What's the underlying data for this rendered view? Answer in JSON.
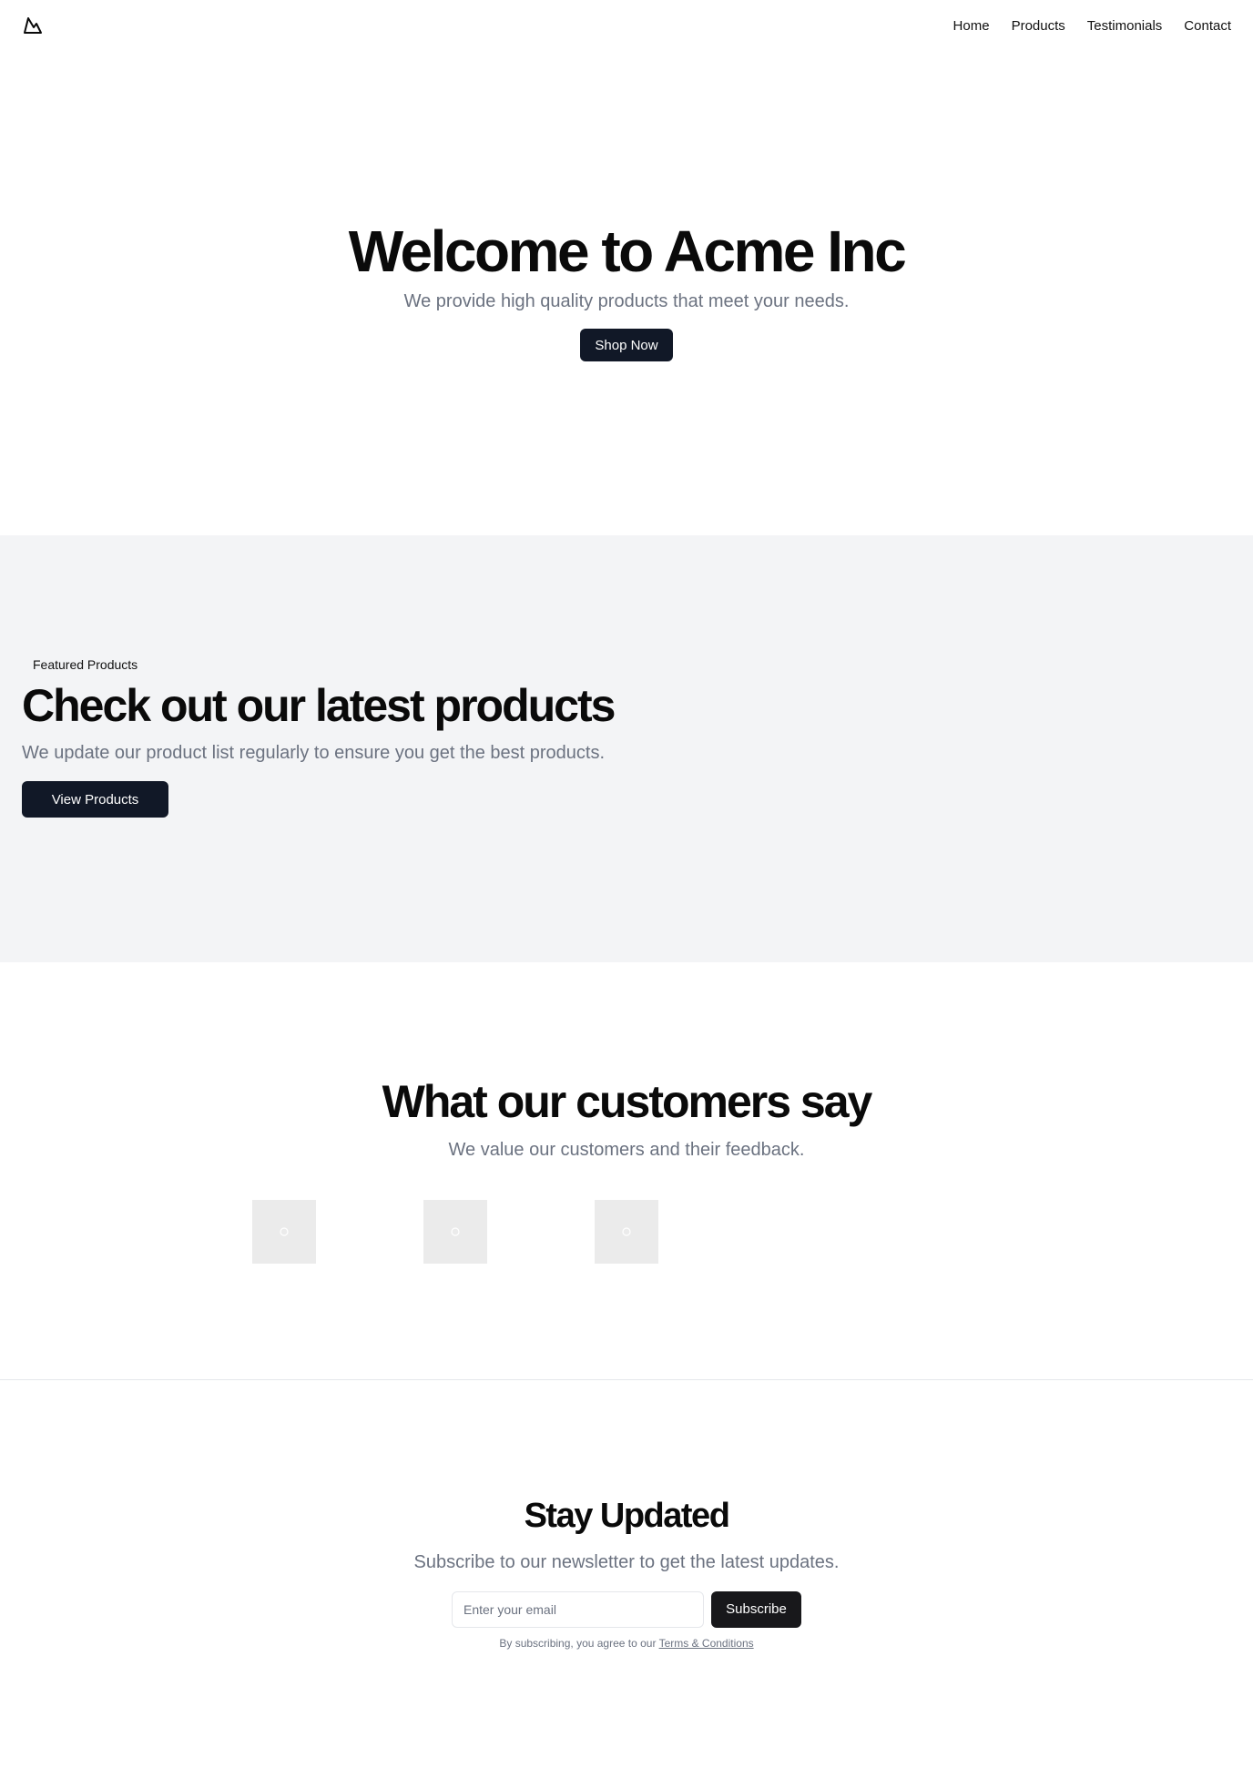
{
  "header": {
    "logo_icon": "mountain-icon",
    "nav": [
      {
        "label": "Home"
      },
      {
        "label": "Products"
      },
      {
        "label": "Testimonials"
      },
      {
        "label": "Contact"
      }
    ]
  },
  "hero": {
    "title": "Welcome to Acme Inc",
    "subtitle": "We provide high quality products that meet your needs.",
    "cta_label": "Shop Now"
  },
  "featured": {
    "badge": "Featured Products",
    "title": "Check out our latest products",
    "subtitle": "We update our product list regularly to ensure you get the best products.",
    "cta_label": "View Products"
  },
  "testimonials": {
    "title": "What our customers say",
    "subtitle": "We value our customers and their feedback.",
    "avatars": [
      {
        "icon": "image-placeholder-icon"
      },
      {
        "icon": "image-placeholder-icon"
      },
      {
        "icon": "image-placeholder-icon"
      }
    ]
  },
  "newsletter": {
    "title": "Stay Updated",
    "subtitle": "Subscribe to our newsletter to get the latest updates.",
    "email_placeholder": "Enter your email",
    "email_value": "",
    "subscribe_label": "Subscribe",
    "terms_prefix": "By subscribing, you agree to our ",
    "terms_link": "Terms & Conditions"
  },
  "colors": {
    "primary": "#111827",
    "muted_text": "#6b7280",
    "section_bg": "#f3f4f6",
    "subscribe_bg": "#18181b"
  }
}
